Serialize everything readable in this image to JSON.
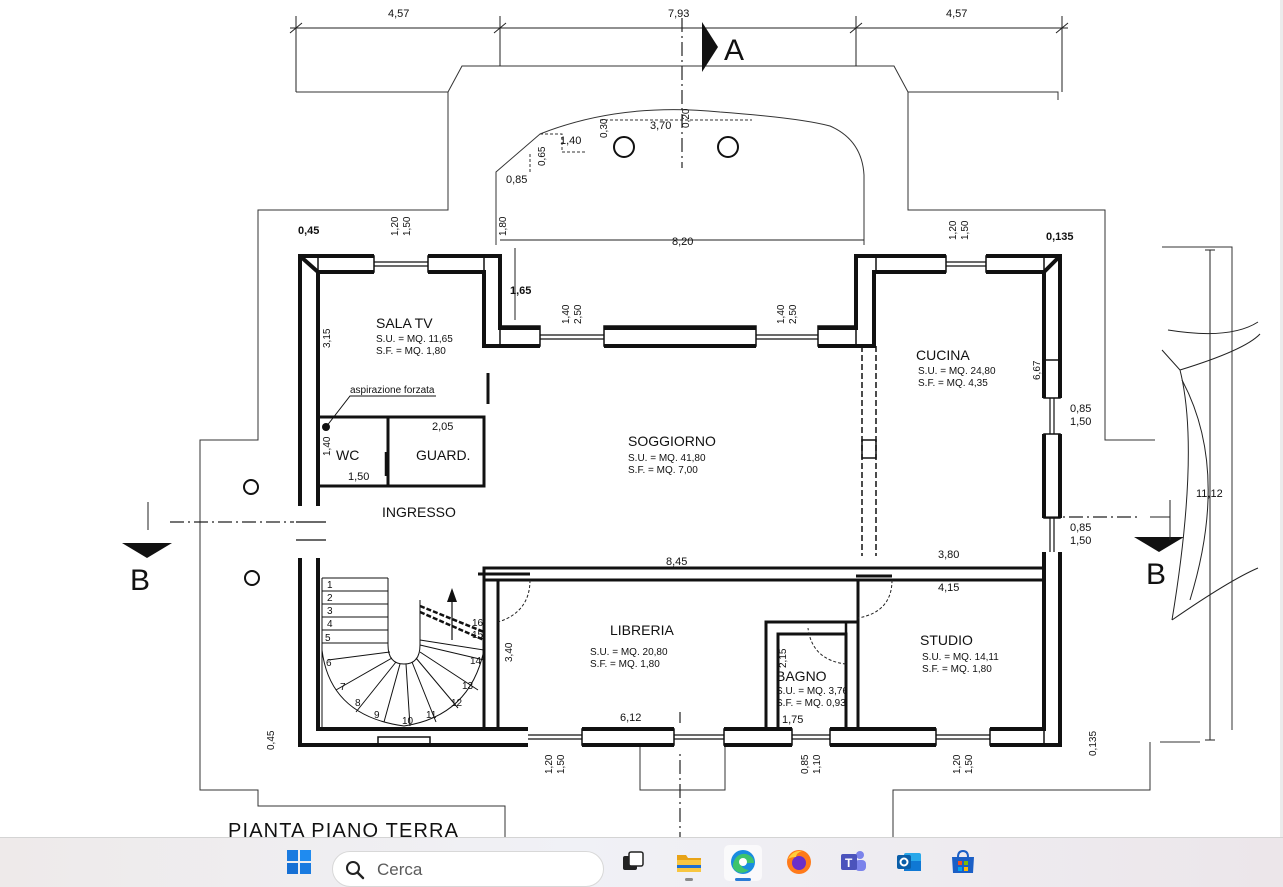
{
  "plan": {
    "title": "PIANTA PIANO TERRA",
    "section_marks": {
      "a": "A",
      "b_left": "B",
      "b_right": "B"
    },
    "rooms": {
      "sala_tv": {
        "name": "SALA TV",
        "su": "S.U. = MQ. 11,65",
        "sf": "S.F. = MQ. 1,80"
      },
      "cucina": {
        "name": "CUCINA",
        "su": "S.U. = MQ. 24,80",
        "sf": "S.F. = MQ. 4,35"
      },
      "soggiorno": {
        "name": "SOGGIORNO",
        "su": "S.U. = MQ. 41,80",
        "sf": "S.F. = MQ. 7,00"
      },
      "wc": {
        "name": "WC"
      },
      "guard": {
        "name": "GUARD."
      },
      "ingresso": {
        "name": "INGRESSO"
      },
      "libreria": {
        "name": "LIBRERIA",
        "su": "S.U. = MQ. 20,80",
        "sf": "S.F. = MQ. 1,80"
      },
      "bagno": {
        "name": "BAGNO",
        "su": "S.U. = MQ. 3,76",
        "sf": "S.F. = MQ. 0,93"
      },
      "studio": {
        "name": "STUDIO",
        "su": "S.U. = MQ. 14,11",
        "sf": "S.F. = MQ. 1,80"
      }
    },
    "note": "aspirazione forzata",
    "dims": {
      "top_left": "4,57",
      "top_center": "7,93",
      "top_right": "4,57",
      "porch_370": "3,70",
      "porch_030": "0,30",
      "porch_020": "0,20",
      "porch_140": "1,40",
      "porch_065": "0,65",
      "porch_085": "0,85",
      "porch_180": "1,80",
      "porch_820": "8,20",
      "wall_045_top": "0,45",
      "win_120_tl": "1,20",
      "win_150_tl": "1,50",
      "win_120_tr": "1,20",
      "win_150_tr": "1,50",
      "wall_0135_top": "0,135",
      "d_165": "1,65",
      "sog_140_l": "1,40",
      "sog_250_l": "2,50",
      "sog_140_r": "1,40",
      "sog_250_r": "2,50",
      "d_315": "3,15",
      "d_205": "2,05",
      "d_140_wc": "1,40",
      "d_150_wc": "1,50",
      "d_667": "6,67",
      "d_085_a": "0,85",
      "d_150_a": "1,50",
      "d_085_b": "0,85",
      "d_150_b": "1,50",
      "d_1112": "11,12",
      "d_845": "8,45",
      "d_380": "3,80",
      "d_415": "4,15",
      "d_340": "3,40",
      "d_215": "2,15",
      "d_175": "1,75",
      "d_612": "6,12",
      "wall_045_bot": "0,45",
      "win_120_bl": "1,20",
      "win_150_bl": "1,50",
      "d_085_bot": "0,85",
      "d_110_bot": "1,10",
      "win_120_br": "1,20",
      "win_150_br": "1,50",
      "wall_0135_bot": "0,135"
    },
    "stairs": [
      "1",
      "2",
      "3",
      "4",
      "5",
      "6",
      "7",
      "8",
      "9",
      "10",
      "11",
      "12",
      "13",
      "14",
      "15",
      "16"
    ]
  },
  "taskbar": {
    "search_placeholder": "Cerca",
    "apps": [
      "start-icon",
      "search",
      "task-view-icon",
      "file-explorer-icon",
      "edge-icon",
      "firefox-icon",
      "teams-icon",
      "outlook-icon",
      "store-icon"
    ]
  }
}
